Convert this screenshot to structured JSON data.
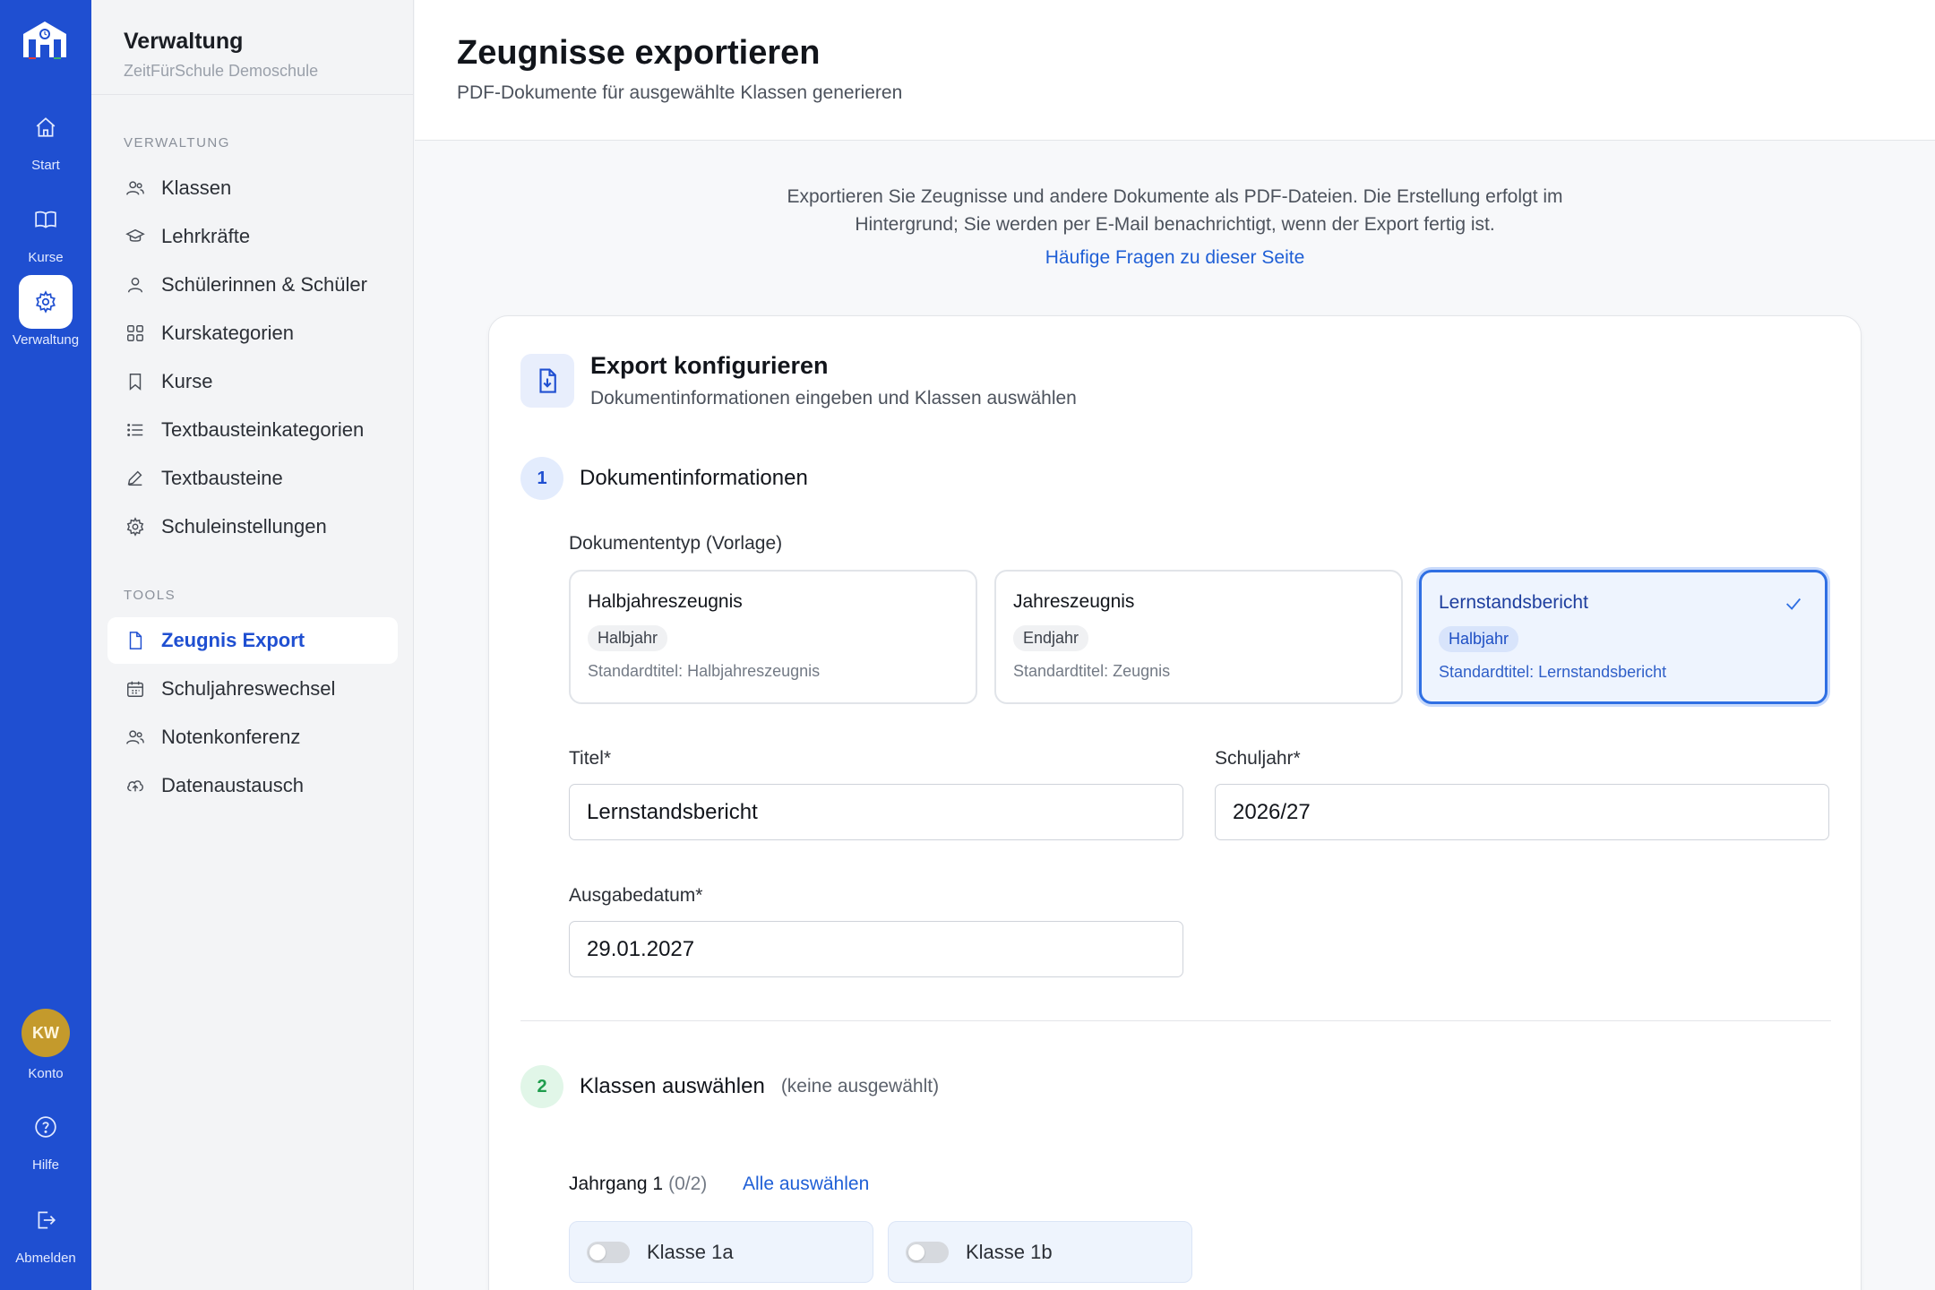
{
  "rail": {
    "items": [
      {
        "label": "Start",
        "icon": "home-icon"
      },
      {
        "label": "Kurse",
        "icon": "book-icon"
      },
      {
        "label": "Verwaltung",
        "icon": "gear-icon"
      }
    ],
    "account": {
      "initials": "KW",
      "label": "Konto"
    },
    "help": {
      "label": "Hilfe",
      "icon": "help-icon"
    },
    "logout": {
      "label": "Abmelden",
      "icon": "logout-icon"
    }
  },
  "sidebar": {
    "title": "Verwaltung",
    "subtitle": "ZeitFürSchule Demoschule",
    "section1": "VERWALTUNG",
    "items1": [
      {
        "label": "Klassen",
        "icon": "users-icon"
      },
      {
        "label": "Lehrkräfte",
        "icon": "graduation-cap-icon"
      },
      {
        "label": "Schülerinnen & Schüler",
        "icon": "user-icon"
      },
      {
        "label": "Kurskategorien",
        "icon": "grid-icon"
      },
      {
        "label": "Kurse",
        "icon": "bookmark-icon"
      },
      {
        "label": "Textbausteinkategorien",
        "icon": "list-icon"
      },
      {
        "label": "Textbausteine",
        "icon": "edit-icon"
      },
      {
        "label": "Schuleinstellungen",
        "icon": "gear-icon"
      }
    ],
    "section2": "TOOLS",
    "items2": [
      {
        "label": "Zeugnis Export",
        "icon": "file-icon",
        "active": true
      },
      {
        "label": "Schuljahreswechsel",
        "icon": "calendar-icon"
      },
      {
        "label": "Notenkonferenz",
        "icon": "users-icon"
      },
      {
        "label": "Datenaustausch",
        "icon": "cloud-upload-icon"
      }
    ]
  },
  "header": {
    "title": "Zeugnisse exportieren",
    "subtitle": "PDF-Dokumente für ausgewählte Klassen generieren"
  },
  "intro": {
    "text": "Exportieren Sie Zeugnisse und andere Dokumente als PDF-Dateien. Die Erstellung erfolgt im Hintergrund; Sie werden per E-Mail benachrichtigt, wenn der Export fertig ist.",
    "link": "Häufige Fragen zu dieser Seite"
  },
  "card": {
    "title": "Export konfigurieren",
    "subtitle": "Dokumentinformationen eingeben und Klassen auswählen",
    "step1": {
      "num": "1",
      "title": "Dokumentinformationen"
    },
    "doc_type_label": "Dokumententyp (Vorlage)",
    "doc_types": [
      {
        "name": "Halbjahreszeugnis",
        "period": "Halbjahr",
        "std": "Standardtitel: Halbjahreszeugnis",
        "selected": false
      },
      {
        "name": "Jahreszeugnis",
        "period": "Endjahr",
        "std": "Standardtitel: Zeugnis",
        "selected": false
      },
      {
        "name": "Lernstandsbericht",
        "period": "Halbjahr",
        "std": "Standardtitel: Lernstandsbericht",
        "selected": true
      }
    ],
    "fields": {
      "title_label": "Titel*",
      "title_value": "Lernstandsbericht",
      "year_label": "Schuljahr*",
      "year_value": "2026/27",
      "date_label": "Ausgabedatum*",
      "date_value": "29.01.2027"
    },
    "step2": {
      "num": "2",
      "title": "Klassen auswählen",
      "note": "(keine ausgewählt)"
    },
    "grade": {
      "label": "Jahrgang 1",
      "count": "(0/2)",
      "select_all": "Alle auswählen"
    },
    "classes": [
      {
        "label": "Klasse 1a",
        "on": false
      },
      {
        "label": "Klasse 1b",
        "on": false
      }
    ]
  },
  "colors": {
    "primary": "#1f4fd1",
    "link": "#1f5fd6",
    "selected_border": "#2f6fe3",
    "success": "#1f9d4d"
  }
}
